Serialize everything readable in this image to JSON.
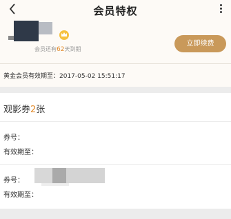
{
  "navbar": {
    "title": "会员特权",
    "back_icon": "chevron-left-icon",
    "more_icon": "more-vertical-icon"
  },
  "member": {
    "expire_prefix": "会员还有",
    "expire_days": "62",
    "expire_suffix": "天到期",
    "renew_label": "立即续费",
    "badge_icon": "crown-icon"
  },
  "validity": {
    "text": "黄金会员有效期至：2017-05-02 15:51:17"
  },
  "tickets": {
    "title_prefix": "观影券",
    "count": "2",
    "title_suffix": "张",
    "items": [
      {
        "number_label": "券号：",
        "expiry_label": "有效期至："
      },
      {
        "number_label": "券号：",
        "expiry_label": "有效期至："
      }
    ]
  },
  "colors": {
    "accent": "#c9995a",
    "highlight": "#e28a2a",
    "header_bg": "#fdfaf6",
    "page_bg": "#ececec"
  }
}
